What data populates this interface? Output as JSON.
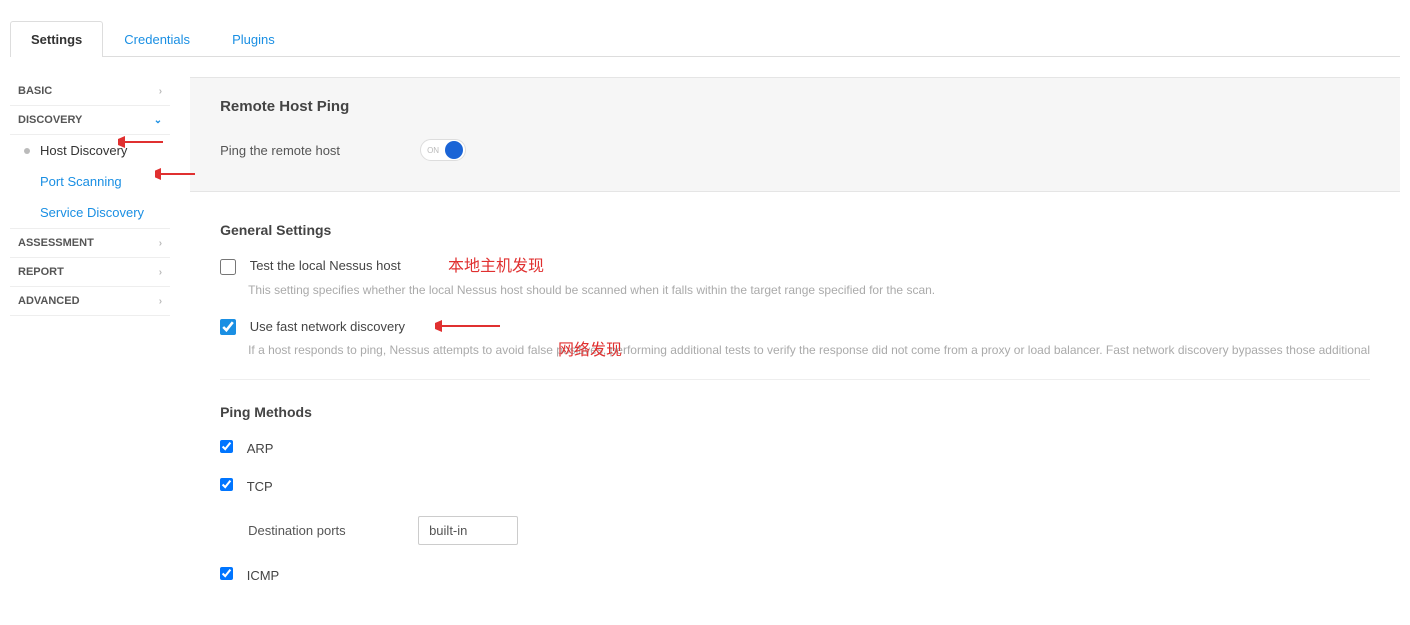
{
  "tabs": {
    "settings": "Settings",
    "credentials": "Credentials",
    "plugins": "Plugins"
  },
  "sidebar": {
    "basic": "BASIC",
    "discovery": "DISCOVERY",
    "host_discovery": "Host Discovery",
    "port_scanning": "Port Scanning",
    "service_discovery": "Service Discovery",
    "assessment": "ASSESSMENT",
    "report": "REPORT",
    "advanced": "ADVANCED"
  },
  "remote_host_ping": {
    "title": "Remote Host Ping",
    "label": "Ping the remote host",
    "toggle_on": "ON"
  },
  "general_settings": {
    "title": "General Settings",
    "test_local_label": "Test the local Nessus host",
    "test_local_desc": "This setting specifies whether the local Nessus host should be scanned when it falls within the target range specified for the scan.",
    "fast_net_label": "Use fast network discovery",
    "fast_net_desc": "If a host responds to ping, Nessus attempts to avoid false positives, performing additional tests to verify the response did not come from a proxy or load balancer. Fast network discovery bypasses those additional"
  },
  "ping_methods": {
    "title": "Ping Methods",
    "arp": "ARP",
    "tcp": "TCP",
    "dest_ports_label": "Destination ports",
    "dest_ports_value": "built-in",
    "icmp": "ICMP"
  },
  "annotations": {
    "local_host": "本地主机发现",
    "network": "网络发现"
  }
}
